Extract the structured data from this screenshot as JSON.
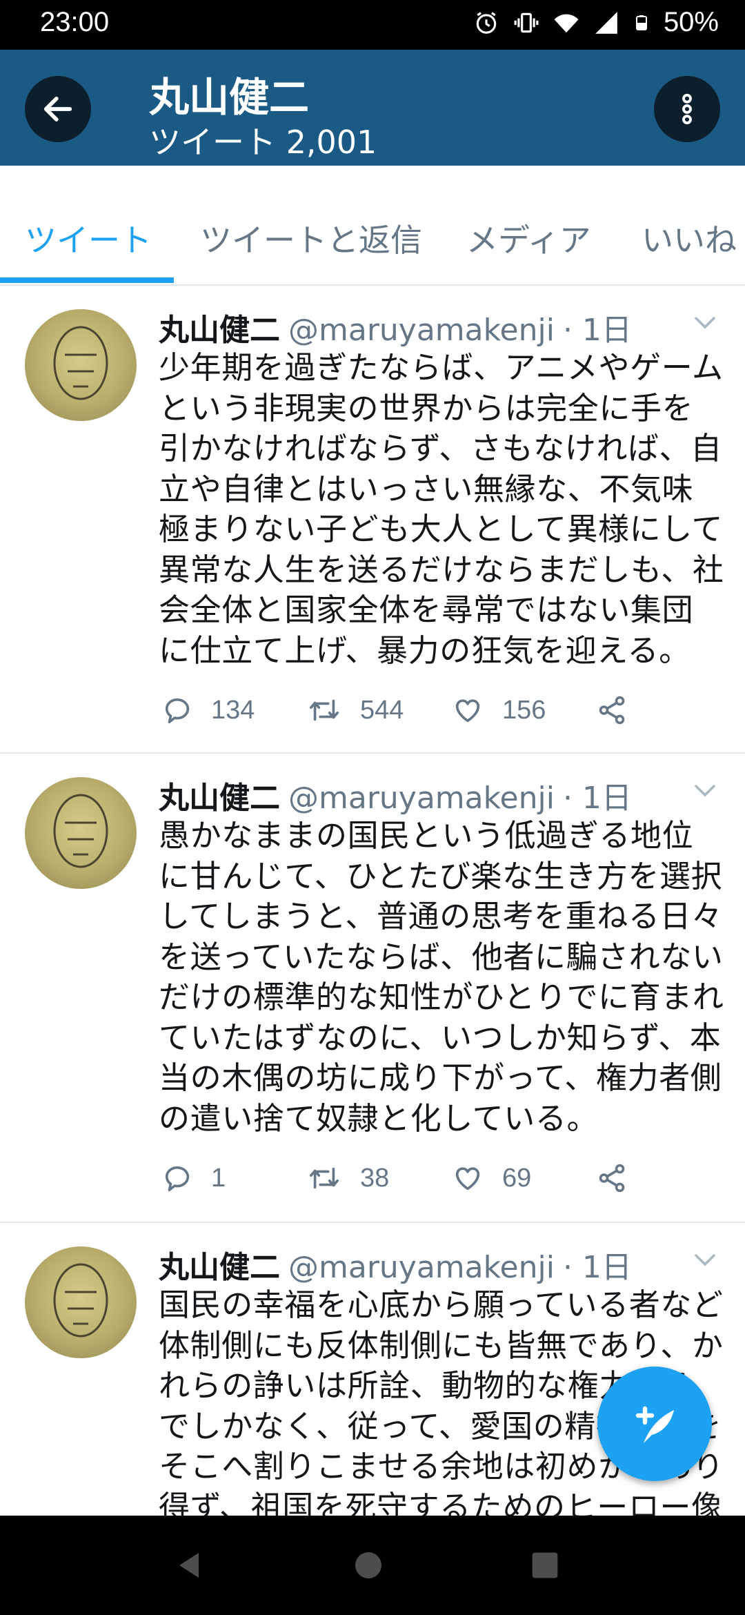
{
  "status": {
    "time": "23:00",
    "battery": "50%"
  },
  "header": {
    "name": "丸山健二",
    "subtitle": "ツイート 2,001"
  },
  "tabs": [
    {
      "label": "ツイート",
      "active": true
    },
    {
      "label": "ツイートと返信",
      "active": false
    },
    {
      "label": "メディア",
      "active": false
    },
    {
      "label": "いいね",
      "active": false
    }
  ],
  "tweets": [
    {
      "name": "丸山健二",
      "handle": "@maruyamakenji",
      "time": "· 1日",
      "text": "少年期を過ぎたならば、アニメやゲームという非現実の世界からは完全に手を引かなければならず、さもなければ、自立や自律とはいっさい無縁な、不気味極まりない子ども大人として異様にして異常な人生を送るだけならまだしも、社会全体と国家全体を尋常ではない集団に仕立て上げ、暴力の狂気を迎える。",
      "replies": "134",
      "retweets": "544",
      "likes": "156"
    },
    {
      "name": "丸山健二",
      "handle": "@maruyamakenji",
      "time": "· 1日",
      "text": "愚かなままの国民という低過ぎる地位に甘んじて、ひとたび楽な生き方を選択してしまうと、普通の思考を重ねる日々を送っていたならば、他者に騙されないだけの標準的な知性がひとりでに育まれていたはずなのに、いつしか知らず、本当の木偶の坊に成り下がって、権力者側の遣い捨て奴隷と化している。",
      "replies": "1",
      "retweets": "38",
      "likes": "69"
    },
    {
      "name": "丸山健二",
      "handle": "@maruyamakenji",
      "time": "· 1日",
      "text": "国民の幸福を心底から願っている者など体制側にも反体制側にも皆無であり、かれらの諍いは所詮、動物的な権力闘争でしかなく、従って、愛国の精神などをそこへ割りこませる余地は初めからあり得ず、祖国を死守するためのヒーロー像"
    }
  ],
  "icons": {
    "back": "arrow-left-icon",
    "more": "more-vertical-icon",
    "reply": "reply-icon",
    "retweet": "retweet-icon",
    "like": "heart-icon",
    "share": "share-icon",
    "compose": "compose-tweet-icon"
  },
  "colors": {
    "appbar": "#1c5a86",
    "accent": "#1da1f2",
    "muted": "#657786"
  }
}
